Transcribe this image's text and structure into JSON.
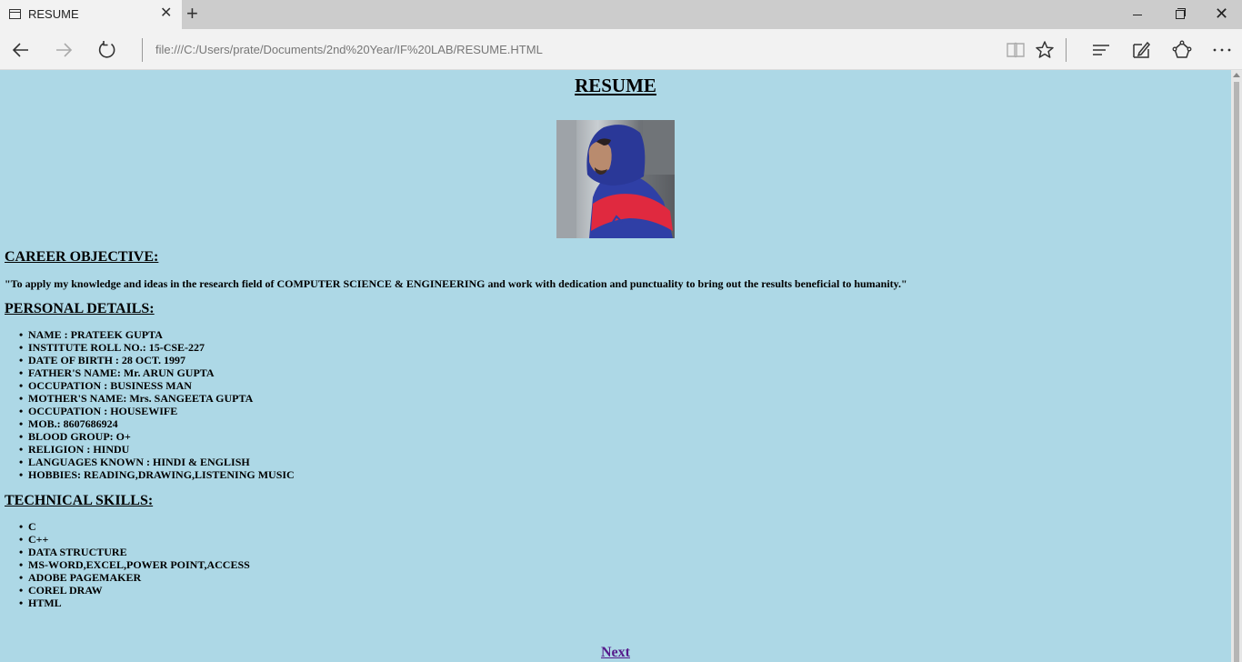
{
  "browser": {
    "tab_title": "RESUME",
    "address": "file:///C:/Users/prate/Documents/2nd%20Year/IF%20LAB/RESUME.HTML"
  },
  "resume": {
    "title": "RESUME",
    "career_heading": "CAREER OBJECTIVE:",
    "career_text": "\"To apply my knowledge and ideas in the research field of COMPUTER SCIENCE & ENGINEERING and work with dedication and punctuality to bring out the results beneficial to humanity.\"",
    "personal_heading": "PERSONAL DETAILS:",
    "personal_details": [
      "NAME : PRATEEK GUPTA",
      "INSTITUTE ROLL NO.: 15-CSE-227",
      "DATE OF BIRTH : 28 OCT. 1997",
      "FATHER'S NAME: Mr. ARUN GUPTA",
      "OCCUPATION : BUSINESS MAN",
      "MOTHER'S NAME: Mrs. SANGEETA GUPTA",
      "OCCUPATION : HOUSEWIFE",
      "MOB.: 8607686924",
      "BLOOD GROUP: O+",
      "RELIGION : HINDU",
      "LANGUAGES KNOWN : HINDI & ENGLISH",
      "HOBBIES: READING,DRAWING,LISTENING MUSIC"
    ],
    "skills_heading": "TECHNICAL SKILLS:",
    "technical_skills": [
      "C",
      "C++",
      "DATA STRUCTURE",
      "MS-WORD,EXCEL,POWER POINT,ACCESS",
      "ADOBE PAGEMAKER",
      "COREL DRAW",
      "HTML"
    ],
    "next_link": "Next"
  },
  "colors": {
    "page_background": "#add8e6",
    "visited_link": "#551a8b"
  }
}
